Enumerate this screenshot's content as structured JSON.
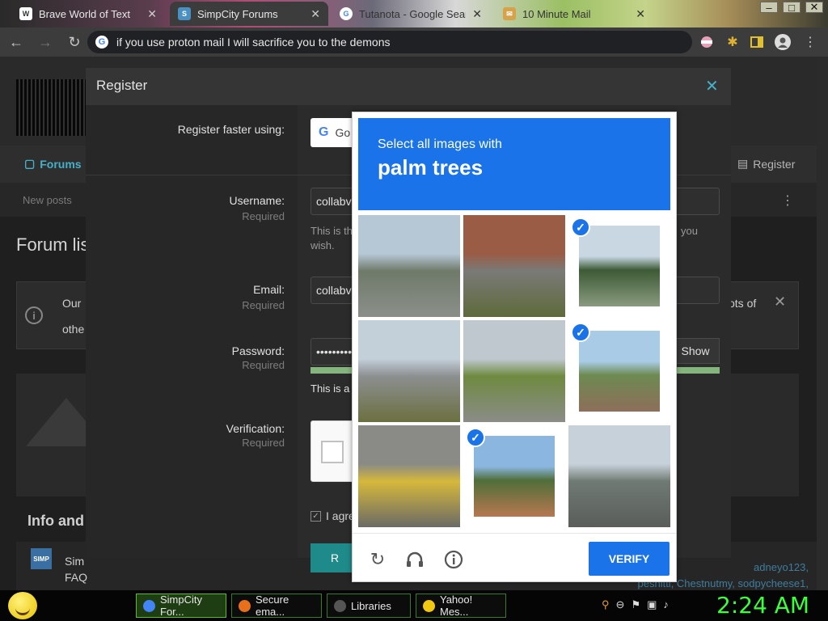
{
  "browser": {
    "tabs": [
      {
        "title": "Brave World of Text",
        "icon": "w-icon"
      },
      {
        "title": "SimpCity Forums",
        "icon": "simp-icon"
      },
      {
        "title": "Tutanota - Google Search",
        "icon": "google-icon"
      },
      {
        "title": "10 Minute Mail",
        "icon": "mail-icon"
      }
    ],
    "address": "if you use proton mail I will sacrifice you to the demons"
  },
  "page": {
    "nav_forums": "Forums",
    "nav_register": "Register",
    "new_posts": "New posts",
    "forum_list_title": "Forum lis",
    "notice_line1": "Our",
    "notice_line2": "othe",
    "notice_right": "ots of",
    "info_heading": "Info and",
    "simp_line1": "Sim",
    "simp_line2": "FAQ",
    "users_line1": "adneyo123,",
    "users_line2": "peshitti, Chestnutmy, sodpycheese1,"
  },
  "modal": {
    "title": "Register",
    "register_faster": "Register faster using:",
    "google_label": "Go",
    "username_label": "Username:",
    "username_value": "collabv",
    "username_hint": "This is th",
    "username_hint2": "wish.",
    "username_hint_right": "you",
    "email_label": "Email:",
    "email_value": "collabv",
    "password_label": "Password:",
    "password_value": "•••••••••",
    "show_label": "Show",
    "strength_label": "This is a v",
    "verification_label": "Verification:",
    "required": "Required",
    "agree_label": "I agre",
    "register_button": "R"
  },
  "recaptcha": {
    "instruction": "Select all images with",
    "object": "palm trees",
    "verify_label": "VERIFY",
    "tiles": [
      {
        "desc": "road",
        "selected": false,
        "colors": [
          "#b6c7d6",
          "#6f7a6a",
          "#8b8f8a"
        ]
      },
      {
        "desc": "stairs",
        "selected": false,
        "colors": [
          "#9a5c45",
          "#7a7a78",
          "#5e6a3b"
        ]
      },
      {
        "desc": "palms",
        "selected": true,
        "colors": [
          "#c9d7e3",
          "#3d5a36",
          "#8a9a7f"
        ]
      },
      {
        "desc": "overpass",
        "selected": false,
        "colors": [
          "#c3cfd9",
          "#8c8f90",
          "#6b7040"
        ]
      },
      {
        "desc": "grass-road",
        "selected": false,
        "colors": [
          "#bfc8cf",
          "#6f8a40",
          "#8b8c88"
        ]
      },
      {
        "desc": "palm-roof",
        "selected": true,
        "colors": [
          "#a9cbe6",
          "#6d8a52",
          "#8e6e5a"
        ]
      },
      {
        "desc": "yellow-lines",
        "selected": false,
        "colors": [
          "#8a8a86",
          "#d6b83b",
          "#6a6a66"
        ]
      },
      {
        "desc": "palm-house",
        "selected": true,
        "colors": [
          "#8ab6df",
          "#4f6e3a",
          "#b77850"
        ]
      },
      {
        "desc": "street",
        "selected": false,
        "colors": [
          "#c7d1da",
          "#707a74",
          "#5a5d5a"
        ]
      }
    ]
  },
  "taskbar": {
    "items": [
      {
        "label": "SimpCity For...",
        "color": "#4285f4",
        "active": true
      },
      {
        "label": "Secure ema...",
        "color": "#e8701a",
        "active": false
      },
      {
        "label": "Libraries",
        "color": "#555555",
        "active": false
      },
      {
        "label": "Yahoo! Mes...",
        "color": "#f2c811",
        "active": false
      }
    ],
    "clock": "2:24 AM"
  }
}
